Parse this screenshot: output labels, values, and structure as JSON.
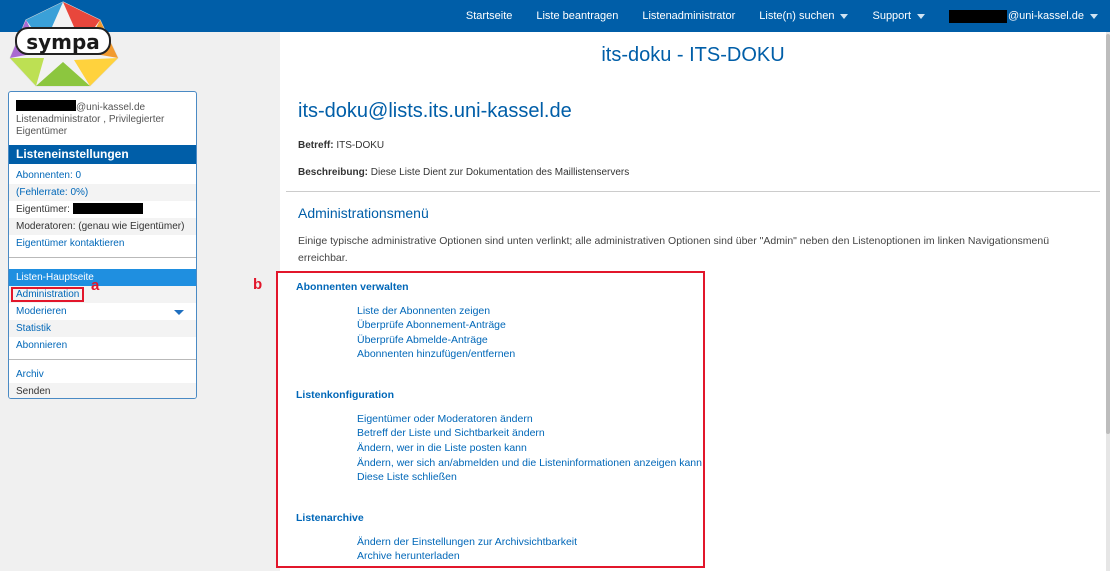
{
  "nav": {
    "items": [
      {
        "label": "Startseite",
        "dropdown": false
      },
      {
        "label": "Liste beantragen",
        "dropdown": false
      },
      {
        "label": "Listenadministrator",
        "dropdown": false
      },
      {
        "label": "Liste(n) suchen",
        "dropdown": true
      },
      {
        "label": "Support",
        "dropdown": true
      }
    ],
    "user_suffix": "@uni-kassel.de"
  },
  "logo": {
    "text": "sympa"
  },
  "sidebar": {
    "user_suffix": "@uni-kassel.de",
    "user_roles": "Listenadministrator , Privilegierter Eigentümer",
    "section_title": "Listeneinstellungen",
    "subscribers": "Abonnenten: 0",
    "error_rate": "(Fehlerrate: 0%)",
    "owners_label": "Eigentümer:",
    "moderators": "Moderatoren: (genau wie Eigentümer)",
    "contact_owners": "Eigentümer kontaktieren",
    "main_page": "Listen-Hauptseite",
    "administration": "Administration",
    "moderate": "Moderieren",
    "statistics": "Statistik",
    "subscribe": "Abonnieren",
    "archive": "Archiv",
    "send": "Senden"
  },
  "markers": {
    "a": "a",
    "b": "b"
  },
  "main": {
    "page_title": "its-doku - ITS-DOKU",
    "list_address": "its-doku@lists.its.uni-kassel.de",
    "subject_label": "Betreff:",
    "subject_value": "ITS-DOKU",
    "description_label": "Beschreibung:",
    "description_value": "Diese Liste Dient zur Dokumentation des Maillistenservers",
    "admin_menu_title": "Administrationsmenü",
    "admin_menu_desc": "Einige typische administrative Optionen sind unten verlinkt; alle administrativen Optionen sind über \"Admin\" neben den Listenoptionen im linken Navigationsmenü erreichbar."
  },
  "admin_menu": {
    "subscribers": {
      "title": "Abonnenten verwalten",
      "links": [
        "Liste der Abonnenten zeigen",
        "Überprüfe Abonnement-Anträge",
        "Überprüfe Abmelde-Anträge",
        "Abonnenten hinzufügen/entfernen"
      ]
    },
    "config": {
      "title": "Listenkonfiguration",
      "links": [
        "Eigentümer oder Moderatoren ändern",
        "Betreff der Liste und Sichtbarkeit ändern",
        "Ändern, wer in die Liste posten kann",
        "Ändern, wer sich an/abmelden und die Listeninformationen anzeigen kann",
        "Diese Liste schließen"
      ]
    },
    "archives": {
      "title": "Listenarchive",
      "links": [
        "Ändern der Einstellungen zur Archivsichtbarkeit",
        "Archive herunterladen"
      ]
    }
  },
  "colors": {
    "brand": "#005ea8",
    "link": "#0067b8",
    "highlight": "#e2162b",
    "active": "#1f8fe0"
  }
}
